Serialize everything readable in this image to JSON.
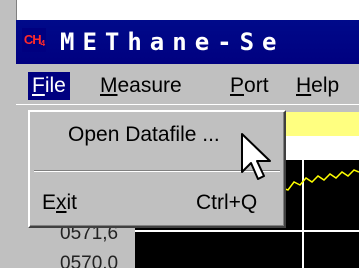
{
  "window": {
    "app_icon": {
      "text": "CH",
      "sub": "4",
      "icon": "methane-app-icon",
      "color": "#ff2a2a"
    },
    "title": "METhane-Se"
  },
  "menubar": {
    "items": [
      {
        "label_first": "F",
        "label_rest": "ile"
      },
      {
        "label_first": "M",
        "label_rest": "easure"
      },
      {
        "label_first": "P",
        "label_rest": "ort"
      },
      {
        "label_first": "H",
        "label_rest": "elp"
      }
    ]
  },
  "file_menu": {
    "open": "Open Datafile ...",
    "exit_first": "E",
    "exit_mid": "x",
    "exit_rest": "it",
    "exit_shortcut": "Ctrl+Q"
  },
  "axis": {
    "labels": [
      "0571,6",
      "0570,0"
    ]
  },
  "colors": {
    "titlebar": "#000080",
    "face": "#c0c0c0",
    "graph_bg": "#000000",
    "trace": "#ffff00",
    "highlight": "#ffff80"
  },
  "cursor": {
    "icon": "arrow-cursor-icon"
  }
}
